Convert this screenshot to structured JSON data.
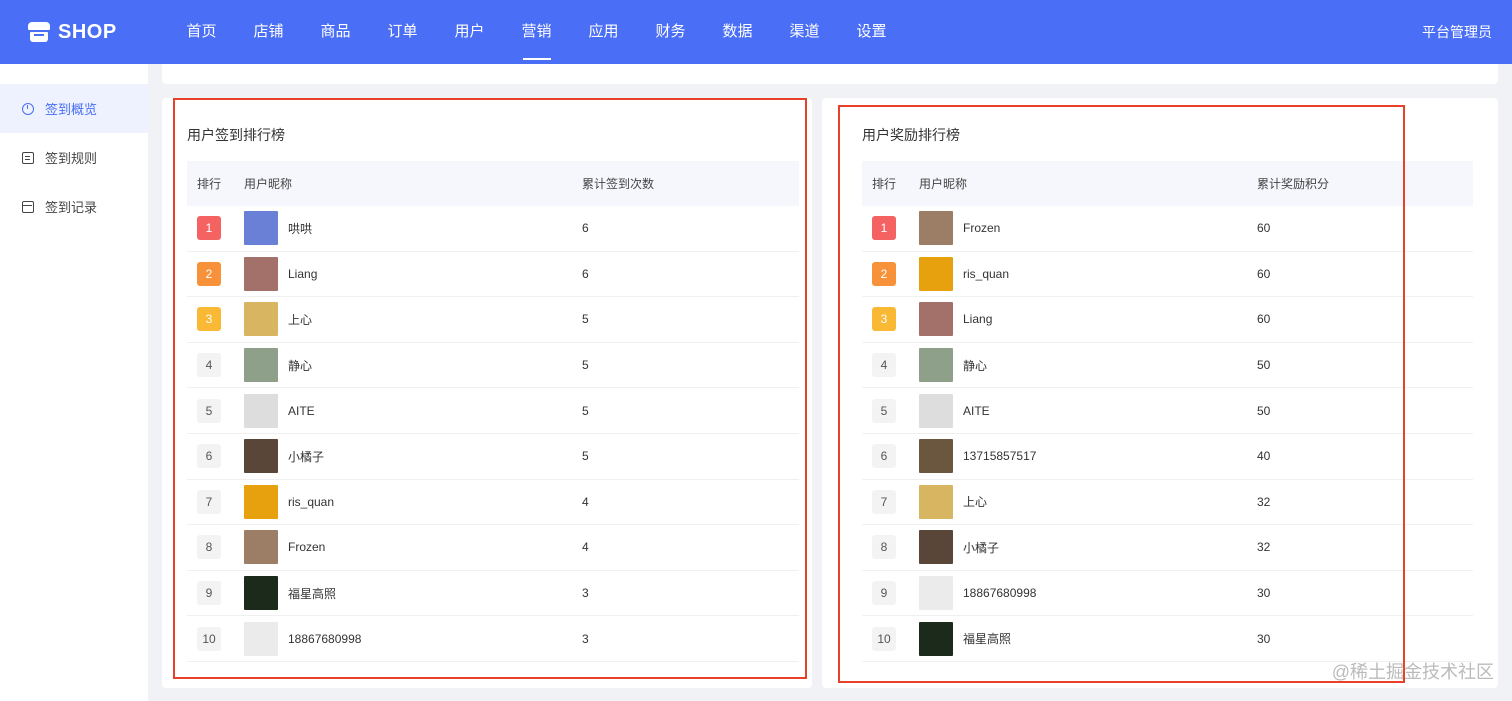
{
  "brand": {
    "name": "SHOP"
  },
  "nav": [
    "首页",
    "店铺",
    "商品",
    "订单",
    "用户",
    "营销",
    "应用",
    "财务",
    "数据",
    "渠道",
    "设置"
  ],
  "nav_active": "营销",
  "admin": "平台管理员",
  "sidebar": [
    {
      "label": "签到概览",
      "icon": "clock-icon",
      "active": true
    },
    {
      "label": "签到规则",
      "icon": "document-icon",
      "active": false
    },
    {
      "label": "签到记录",
      "icon": "calendar-icon",
      "active": false
    }
  ],
  "left_panel": {
    "title": "用户签到排行榜",
    "headers": [
      "排行",
      "用户昵称",
      "累计签到次数"
    ],
    "rows": [
      {
        "rank": "1",
        "name": "哄哄",
        "value": "6",
        "avatar": "#6a7fd6"
      },
      {
        "rank": "2",
        "name": "Liang",
        "value": "6",
        "avatar": "#a4706a"
      },
      {
        "rank": "3",
        "name": "上心",
        "value": "5",
        "avatar": "#d8b560"
      },
      {
        "rank": "4",
        "name": "静心",
        "value": "5",
        "avatar": "#8fa08a"
      },
      {
        "rank": "5",
        "name": "AITE",
        "value": "5",
        "avatar": "#dddddd"
      },
      {
        "rank": "6",
        "name": "小橘子",
        "value": "5",
        "avatar": "#5a4638"
      },
      {
        "rank": "7",
        "name": "ris_quan",
        "value": "4",
        "avatar": "#e8a10e"
      },
      {
        "rank": "8",
        "name": "Frozen",
        "value": "4",
        "avatar": "#9c7d66"
      },
      {
        "rank": "9",
        "name": "福星高照",
        "value": "3",
        "avatar": "#1c2a1c"
      },
      {
        "rank": "10",
        "name": "18867680998",
        "value": "3",
        "avatar": "#ebebeb"
      }
    ]
  },
  "right_panel": {
    "title": "用户奖励排行榜",
    "headers": [
      "排行",
      "用户昵称",
      "累计奖励积分"
    ],
    "rows": [
      {
        "rank": "1",
        "name": "Frozen",
        "value": "60",
        "avatar": "#9c7d66"
      },
      {
        "rank": "2",
        "name": "ris_quan",
        "value": "60",
        "avatar": "#e8a10e"
      },
      {
        "rank": "3",
        "name": "Liang",
        "value": "60",
        "avatar": "#a4706a"
      },
      {
        "rank": "4",
        "name": "静心",
        "value": "50",
        "avatar": "#8fa08a"
      },
      {
        "rank": "5",
        "name": "AITE",
        "value": "50",
        "avatar": "#dddddd"
      },
      {
        "rank": "6",
        "name": "13715857517",
        "value": "40",
        "avatar": "#6b5640"
      },
      {
        "rank": "7",
        "name": "上心",
        "value": "32",
        "avatar": "#d8b560"
      },
      {
        "rank": "8",
        "name": "小橘子",
        "value": "32",
        "avatar": "#5a4638"
      },
      {
        "rank": "9",
        "name": "18867680998",
        "value": "30",
        "avatar": "#ebebeb"
      },
      {
        "rank": "10",
        "name": "福星高照",
        "value": "30",
        "avatar": "#1c2a1c"
      }
    ]
  },
  "rank_colors": {
    "1": "#f56262",
    "2": "#f7923a",
    "3": "#f9b934"
  },
  "watermark": "@稀土掘金技术社区"
}
